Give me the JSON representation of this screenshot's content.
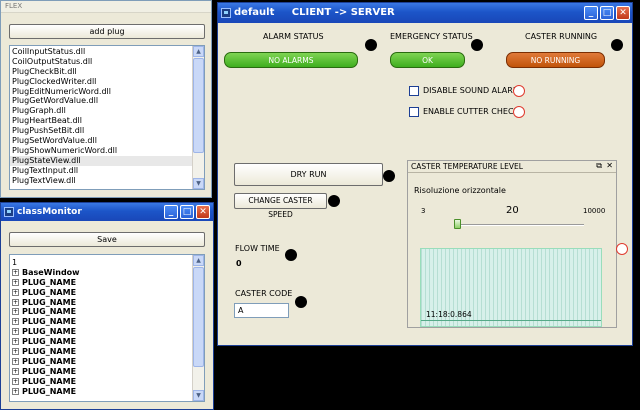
{
  "flex": {
    "title": "FLEX",
    "add_button": "add plug",
    "plugins": [
      "CoilInputStatus.dll",
      "CoilOutputStatus.dll",
      "PlugCheckBit.dll",
      "PlugClockedWriter.dll",
      "PlugEditNumericWord.dll",
      "PlugGetWordValue.dll",
      "PlugGraph.dll",
      "PlugHeartBeat.dll",
      "PlugPushSetBit.dll",
      "PlugSetWordValue.dll",
      "PlugShowNumericWord.dll",
      "PlugStateView.dll",
      "PlugTextInput.dll",
      "PlugTextView.dll"
    ],
    "selected_index": 11
  },
  "classMonitor": {
    "title": "classMonitor",
    "save_button": "Save",
    "root": "1",
    "base": "BaseWindow",
    "child": "PLUG_NAME",
    "child_count": 12
  },
  "main": {
    "title": "default     CLIENT -> SERVER",
    "alarm_status_label": "ALARM STATUS",
    "alarm_status_value": "NO ALARMS",
    "emergency_status_label": "EMERGENCY STATUS",
    "emergency_status_value": "OK",
    "caster_running_label": "CASTER RUNNING",
    "caster_running_value": "NO RUNNING",
    "disable_sound_alarm": "DISABLE SOUND ALARM",
    "enable_cutter_check": "ENABLE CUTTER CHECK",
    "dry_run": "DRY RUN",
    "change_caster_speed": "CHANGE CASTER SPEED",
    "flow_time_label": "FLOW TIME",
    "flow_time_value": "0",
    "caster_code_label": "CASTER CODE",
    "caster_code_value": "A",
    "colors": {
      "green": "#3fae1e",
      "orange": "#c1540a"
    }
  },
  "temp_panel": {
    "title": "CASTER TEMPERATURE LEVEL",
    "subtitle": "Risoluzione orizzontale",
    "min": "3",
    "value": "20",
    "max": "10000",
    "slider_fraction": 0.0017,
    "readout": "11:18:0.864"
  }
}
